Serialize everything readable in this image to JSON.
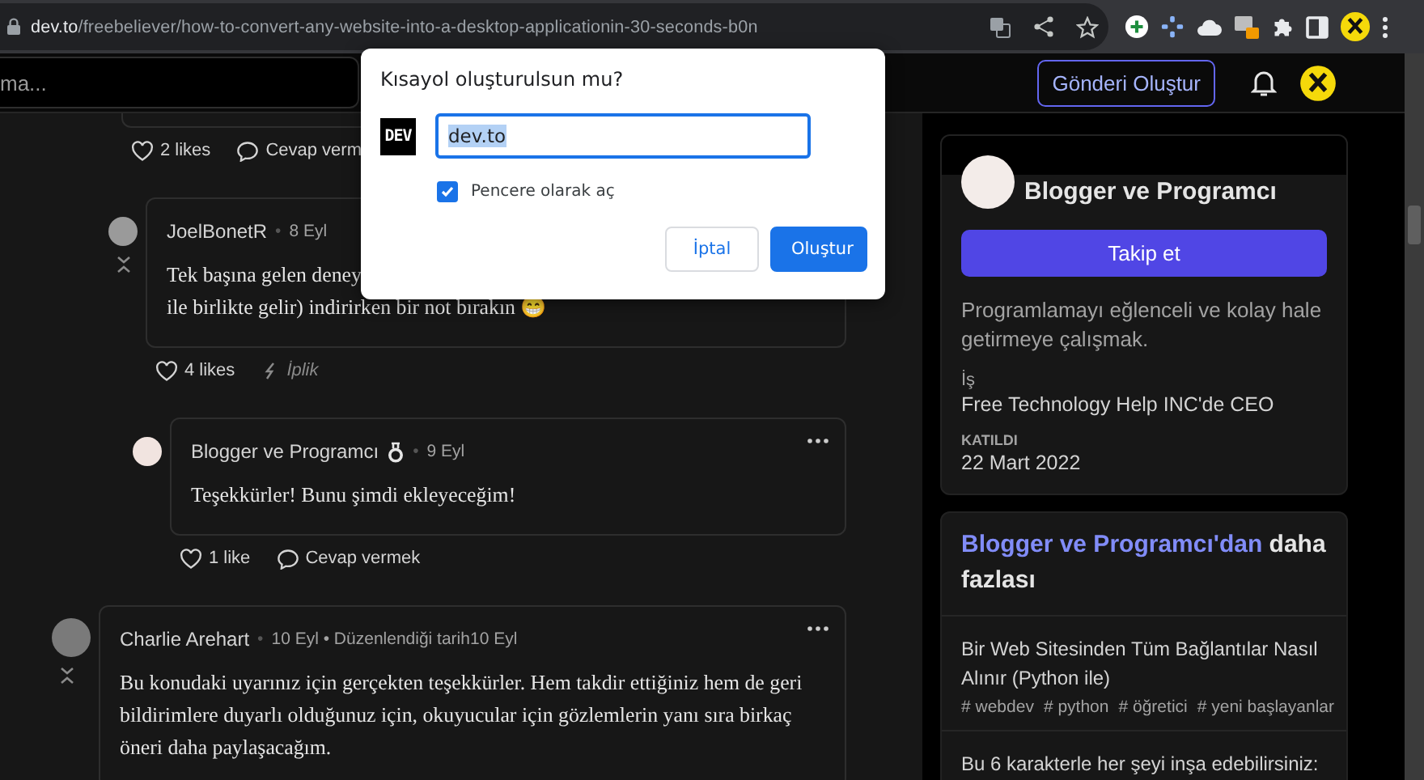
{
  "browser": {
    "url_domain": "dev.to",
    "url_path": "/freebeliever/how-to-convert-any-website-into-a-desktop-applicationin-30-seconds-b0n"
  },
  "header": {
    "search_placeholder": "ma...",
    "create_button": "Gönderi Oluştur"
  },
  "comments": [
    {
      "kind": "partial",
      "likes": "2 likes",
      "reply": {
        "kind": "reply",
        "label": "Cevap verm"
      },
      "children": [
        {
          "kind": "full",
          "author": "JoelBonetR",
          "separator": "•",
          "date": "8 Eyl",
          "author_badge": false,
          "collapsible": true,
          "menu": false,
          "body_lines": [
            "Tek başına gelen deney",
            "ile birlikte gelir) indirirken bir not bırakın 😁"
          ],
          "likes": "4 likes",
          "reply": {
            "kind": "thread",
            "label": "İplik"
          },
          "children": [
            {
              "kind": "full",
              "author": "Blogger ve Programcı",
              "separator": "•",
              "date": "9 Eyl",
              "author_badge": true,
              "collapsible": false,
              "menu": true,
              "body_lines": [
                "Teşekkürler! Bunu şimdi ekleyeceğim!"
              ],
              "likes": "1 like",
              "reply": {
                "kind": "reply",
                "label": "Cevap vermek"
              }
            }
          ]
        }
      ]
    },
    {
      "kind": "full",
      "author": "Charlie Arehart",
      "separator": "•",
      "date": "10 Eyl • Düzenlendiği tarih10 Eyl",
      "author_badge": false,
      "collapsible": true,
      "menu": true,
      "body_lines": [
        "Bu konudaki uyarınız için gerçekten teşekkürler. Hem takdir ettiğiniz hem de geri",
        "bildirimlere duyarlı olduğunuz için, okuyucular için gözlemlerin yanı sıra birkaç",
        "öneri daha paylaşacağım."
      ]
    }
  ],
  "profile": {
    "name": "Blogger ve Programcı",
    "follow_button": "Takip et",
    "bio": "Programlamayı eğlenceli ve kolay hale getirmeye çalışmak.",
    "work_label": "İş",
    "work": "Free Technology Help INC'de CEO",
    "joined_label": "KATILDI",
    "joined": "22 Mart 2022"
  },
  "more": {
    "heading_link": "Blogger ve Programcı'dan",
    "heading_rest": "daha fazlası",
    "articles": [
      {
        "title": "Bir Web Sitesinden Tüm Bağlantılar Nasıl Alınır (Python ile)",
        "tags": [
          "# webdev",
          "# python",
          "# öğretici",
          "# yeni başlayanlar"
        ]
      },
      {
        "title": "Bu 6 karakterle her şeyi inşa edebilirsiniz:"
      }
    ]
  },
  "dialog": {
    "title": "Kısayol oluşturulsun mu?",
    "logo_text": "DEV",
    "input_value": "dev.to",
    "value_selected": true,
    "checkbox_label": "Pencere olarak aç",
    "checked": true,
    "cancel_button": "İptal",
    "create_button": "Oluştur"
  }
}
